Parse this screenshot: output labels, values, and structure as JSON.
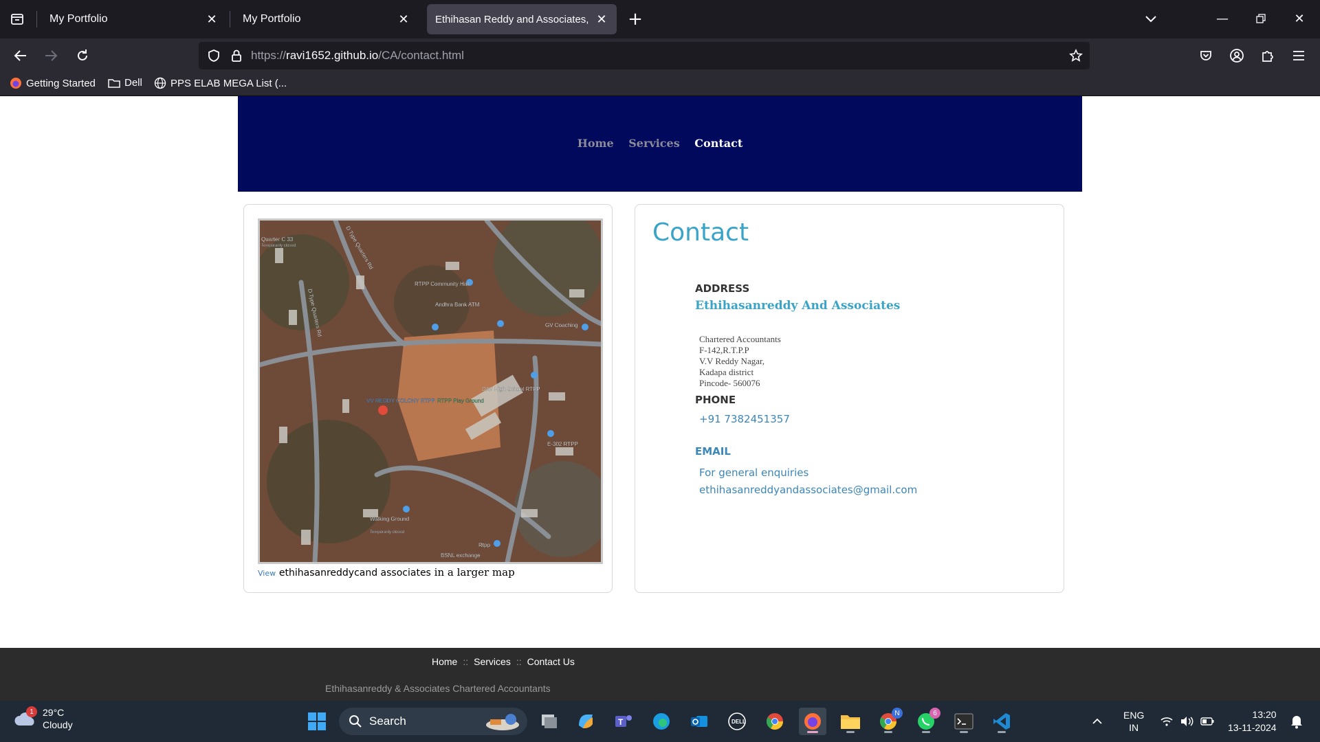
{
  "browser": {
    "tabs": [
      {
        "title": "My Portfolio",
        "active": false
      },
      {
        "title": "My Portfolio",
        "active": false
      },
      {
        "title": "Ethihasan Reddy and Associates, RT",
        "active": true
      }
    ],
    "url_prefix": "https://",
    "url_host": "ravi1652.github.io",
    "url_path": "/CA/contact.html",
    "bookmarks": [
      {
        "label": "Getting Started",
        "icon": "firefox-icon"
      },
      {
        "label": "Dell",
        "icon": "folder-icon"
      },
      {
        "label": "PPS ELAB MEGA List (...",
        "icon": "globe-icon"
      }
    ]
  },
  "site": {
    "nav": [
      "Home",
      "Services",
      "Contact"
    ],
    "nav_current": "Contact",
    "map": {
      "labels": [
        "Quarter C 33",
        "Temporarily closed",
        "D Type Quarters Rd",
        "D Type Quarters Rd",
        "RTPP Community Hall",
        "Andhra Bank ATM",
        "GV Coaching",
        "DAV High School RTPP",
        "RTPP Play Ground",
        "VV REDDY COLONY RTPP",
        "E-302 RTPP",
        "Walking Ground",
        "Temporarily closed",
        "Rtpp",
        "BSNL exchange"
      ],
      "caption_view": "View",
      "caption_name": "ethihasanreddycand associates",
      "caption_tail": "in a larger map"
    },
    "contact": {
      "title": "Contact",
      "address_label": "ADDRESS",
      "company": "Ethihasanreddy And Associates",
      "address_lines": [
        "Chartered Accountants",
        "F-142,R.T.P.P",
        "V.V Reddy Nagar,",
        "Kadapa district",
        "Pincode- 560076"
      ],
      "phone_label": "PHONE",
      "phone": "+91 7382451357",
      "email_label": "EMAIL",
      "email_note": "For general enquiries",
      "email": "ethihasanreddyandassociates@gmail.com"
    },
    "footer": {
      "links": [
        "Home",
        "Services",
        "Contact Us"
      ],
      "separator": "::",
      "copyright": "Ethihasanreddy & Associates Chartered Accountants"
    }
  },
  "taskbar": {
    "weather_temp": "29°C",
    "weather_desc": "Cloudy",
    "weather_badge": "1",
    "search_label": "Search",
    "whatsapp_badge": "6",
    "chrome_badge": "N",
    "lang_top": "ENG",
    "lang_bottom": "IN",
    "time": "13:20",
    "date": "13-11-2024"
  },
  "colors": {
    "header_bg": "#01095c",
    "accent": "#3aa4c8",
    "link": "#3d86b8",
    "footer_bg": "#2c2c2c",
    "taskbar_bg": "#1f2a36"
  }
}
